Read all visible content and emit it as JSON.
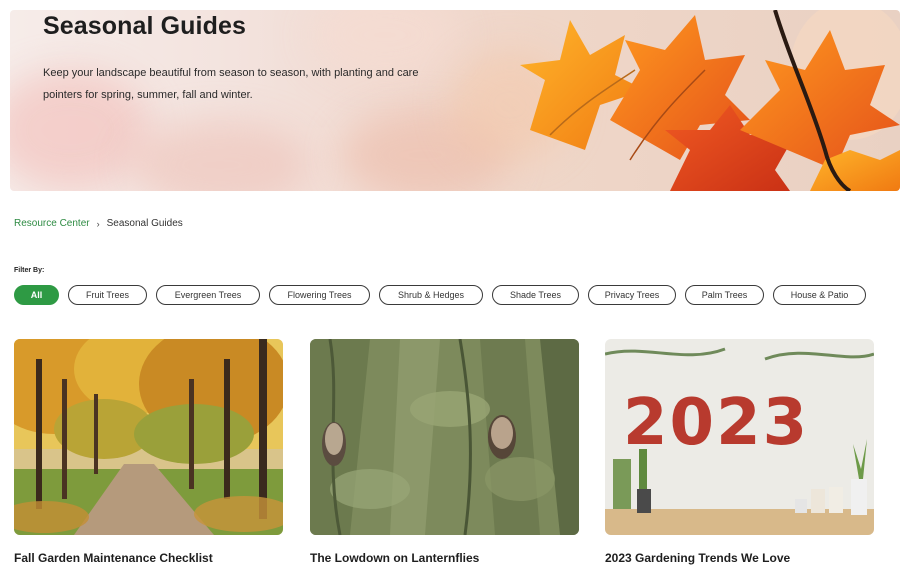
{
  "hero": {
    "title": "Seasonal Guides",
    "description": "Keep your landscape beautiful from season to season, with planting and care pointers for spring, summer, fall and winter."
  },
  "breadcrumb": {
    "items": [
      "Resource Center",
      "Seasonal Guides"
    ],
    "separator": "›"
  },
  "filter": {
    "label": "Filter By:",
    "options": [
      "All",
      "Fruit Trees",
      "Evergreen Trees",
      "Flowering Trees",
      "Shrub & Hedges",
      "Shade Trees",
      "Privacy Trees",
      "Palm Trees",
      "House & Patio"
    ],
    "selected": "All"
  },
  "cards": [
    {
      "title": "Fall Garden Maintenance Checklist",
      "image": "autumn-tree-lined-path"
    },
    {
      "title": "The Lowdown on Lanternflies",
      "image": "lanternflies-on-bark"
    },
    {
      "title": "2023 Gardening Trends We Love",
      "image": "brick-wall-2023-with-plants"
    }
  ],
  "image_text": {
    "year_on_wall": "2023"
  },
  "colors": {
    "accent_green": "#2e9a44",
    "link_green": "#2e8b43",
    "text_dark": "#1e1e1e"
  }
}
